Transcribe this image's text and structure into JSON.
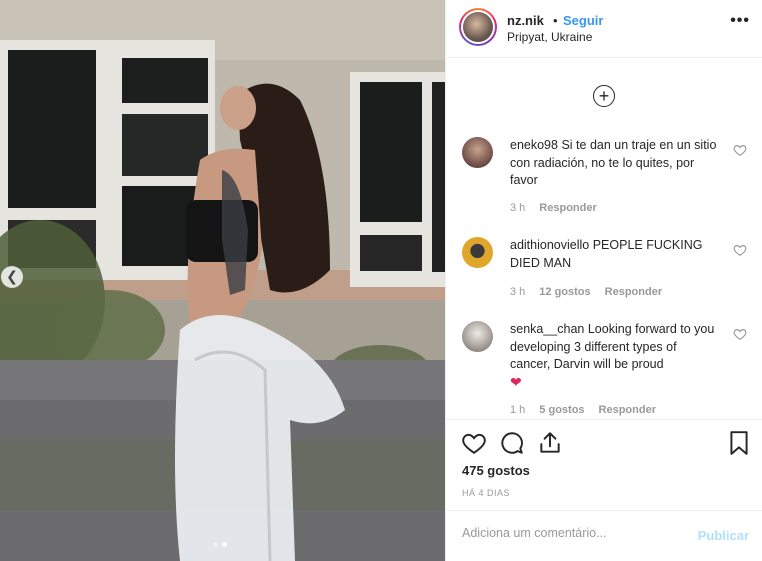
{
  "post": {
    "username": "nz.nik",
    "separator": "•",
    "follow_label": "Seguir",
    "location": "Pripyat, Ukraine",
    "more_icon": "more-horizontal-icon",
    "likes": "475 gostos",
    "time_ago": "HÁ 4 DIAS"
  },
  "comments": [
    {
      "user": "eneko98",
      "text": "Si te dan un traje en un sitio con radiación, no te lo quites, por favor",
      "time": "3 h",
      "likes": "",
      "reply_label": "Responder",
      "avatar_color": "#6b4a45"
    },
    {
      "user": "adithionoviello",
      "text": "PEOPLE FUCKING DIED MAN",
      "time": "3 h",
      "likes": "12 gostos",
      "reply_label": "Responder",
      "avatar_color": "#e0a62c"
    },
    {
      "user": "senka__chan",
      "text": "Looking forward to you developing 3 different types of cancer, Darvin will be proud",
      "emoji": "❤",
      "time": "1 h",
      "likes": "5 gostos",
      "reply_label": "Responder",
      "avatar_color": "#c9c2bd"
    }
  ],
  "composer": {
    "placeholder": "Adiciona um comentário...",
    "publish_label": "Publicar"
  },
  "colors": {
    "accent": "#3897f0",
    "publish_disabled": "#b2dffc",
    "muted": "#999999",
    "text": "#262626"
  }
}
